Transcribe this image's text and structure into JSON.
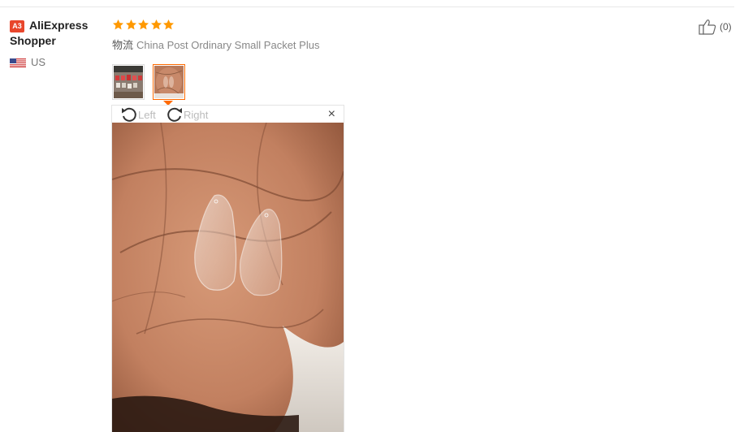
{
  "reviewer": {
    "badge": "A3",
    "name_line1": "AliExpress",
    "name_line2": "Shopper",
    "country": "US",
    "flag_icon": "us-flag-icon"
  },
  "feedback": {
    "rating": 5,
    "rating_max": 5,
    "star_color": "#ff9900",
    "logistics_label": "物流",
    "logistics_value": "China Post Ordinary Small Packet Plus"
  },
  "thumbnails": [
    {
      "name": "photo-thumb-1",
      "icon": "nail-tips-tray-photo",
      "selected": false
    },
    {
      "name": "photo-thumb-2",
      "icon": "nail-tips-in-palm-photo",
      "selected": true
    }
  ],
  "viewer": {
    "rotate_left_label": "Left",
    "rotate_right_label": "Right",
    "close_label": "×",
    "image": "nail-tips-in-palm-photo"
  },
  "helpful": {
    "count_text": "(0)",
    "icon": "thumbs-up-icon"
  },
  "colors": {
    "accent": "#ff6a00",
    "badge": "#e8462b",
    "star": "#ff9900"
  }
}
